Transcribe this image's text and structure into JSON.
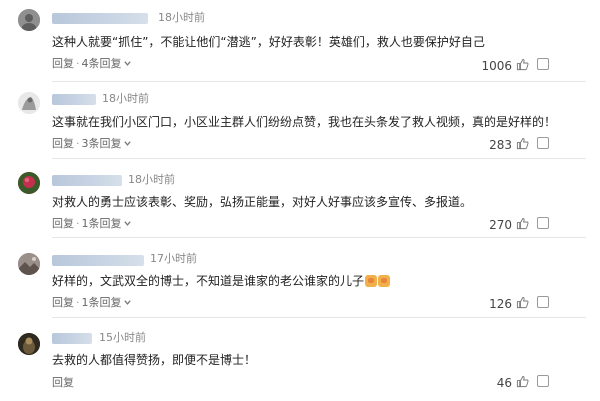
{
  "comments": [
    {
      "time": "18小时前",
      "content": "这种人就要“抓住”，不能让他们“潜逃”，好好表彰！英雄们，救人也要保护好自己",
      "reply_label": "回复",
      "replies_label": "4条回复",
      "likes": "1006",
      "avatar": {
        "icon": "user-avatar-gray",
        "color": "#8a8a8a"
      }
    },
    {
      "time": "18小时前",
      "content": "这事就在我们小区门口，小区业主群人们纷纷点赞，我也在头条发了救人视频，真的是好样的！",
      "reply_label": "回复",
      "replies_label": "3条回复",
      "likes": "283",
      "avatar": {
        "icon": "user-avatar-sketch",
        "color": "#d0d0d0"
      }
    },
    {
      "time": "18小时前",
      "content": "对救人的勇士应该表彰、奖励，弘扬正能量，对好人好事应该多宣传、多报道。",
      "reply_label": "回复",
      "replies_label": "1条回复",
      "likes": "270",
      "avatar": {
        "icon": "user-avatar-red",
        "color": "#b8324a"
      }
    },
    {
      "time": "17小时前",
      "content": "好样的，文武双全的博士，不知道是谁家的老公谁家的儿子",
      "reply_label": "回复",
      "replies_label": "1条回复",
      "likes": "126",
      "avatar": {
        "icon": "user-avatar-landscape",
        "color": "#7e6f69"
      }
    },
    {
      "time": "15小时前",
      "content": "去救的人都值得赞扬，即便不是博士！",
      "reply_label": "回复",
      "replies_label": "",
      "likes": "46",
      "avatar": {
        "icon": "user-avatar-dark",
        "color": "#3b3224"
      }
    }
  ],
  "colors": {
    "text": "#222222",
    "meta": "#888888",
    "username_blur": "#c4d0e0",
    "divider": "#e6e6e6"
  }
}
